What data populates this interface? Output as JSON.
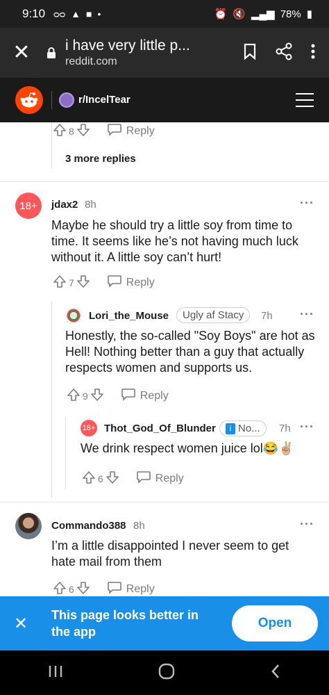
{
  "status_bar": {
    "time": "9:10",
    "battery": "78%"
  },
  "browser": {
    "page_title": "i have very little p...",
    "domain": "reddit.com"
  },
  "reddit_header": {
    "subreddit": "r/IncelTear"
  },
  "top_fragment": {
    "score": "8",
    "reply_label": "Reply",
    "more_replies": "3 more replies"
  },
  "comments": [
    {
      "avatar_text": "18+",
      "username": "jdax2",
      "time": "8h",
      "body": "Maybe he should try a little soy from time to time. It seems like he’s not having much luck without it. A little soy can’t hurt!",
      "score": "7",
      "reply_label": "Reply"
    },
    {
      "username": "Lori_the_Mouse",
      "flair": "Ugly af Stacy",
      "time": "7h",
      "body": "Honestly, the so-called \"Soy Boys\" are hot as Hell! Nothing better than a guy that actually respects women and supports us.",
      "score": "9",
      "reply_label": "Reply"
    },
    {
      "avatar_text": "18+",
      "username": "Thot_God_Of_Blunder",
      "flair": "No...",
      "time": "7h",
      "body": "We drink respect women juice lol😂✌🏼",
      "score": "6",
      "reply_label": "Reply"
    },
    {
      "username": "Commando388",
      "time": "8h",
      "body": "I’m a little disappointed I never seem to get hate mail from them",
      "score": "6",
      "reply_label": "Reply"
    }
  ],
  "app_banner": {
    "text": "This page looks better in the app",
    "open_label": "Open"
  },
  "colors": {
    "reddit_orange": "#ff4500",
    "banner_blue": "#1a8fe8",
    "nsfw_red": "#ff585b"
  }
}
